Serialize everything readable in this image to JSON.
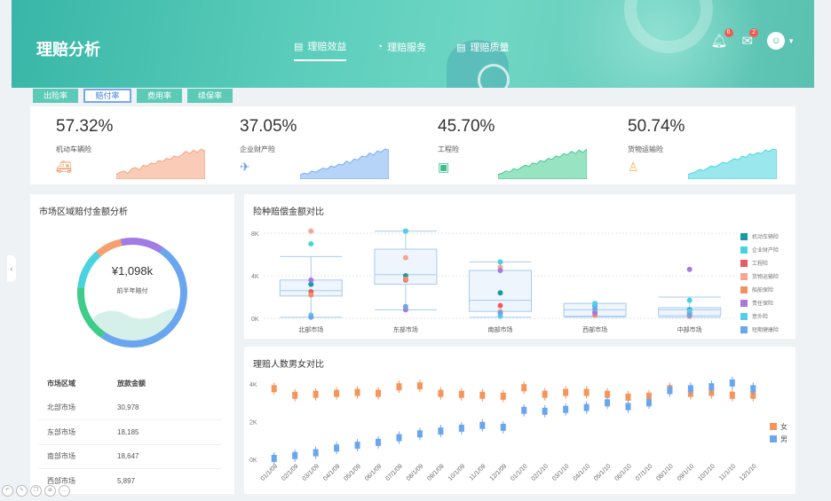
{
  "header": {
    "title": "理赔分析",
    "nav": [
      {
        "label": "理赔效益",
        "icon": "document-icon",
        "active": true
      },
      {
        "label": "理赔服务",
        "icon": "pie-icon",
        "active": false
      },
      {
        "label": "理赔质量",
        "icon": "document-icon",
        "active": false
      }
    ],
    "bell_badge": "6",
    "mail_badge": "2"
  },
  "tabs": [
    {
      "label": "出险率",
      "active": false
    },
    {
      "label": "赔付率",
      "active": true
    },
    {
      "label": "费用率",
      "active": false
    },
    {
      "label": "续保率",
      "active": false
    }
  ],
  "kpis": [
    {
      "value": "57.32%",
      "label": "机动车辆险",
      "color": "#f6a37c",
      "icon": "car-icon"
    },
    {
      "value": "37.05%",
      "label": "企业财产险",
      "color": "#7aaef2",
      "icon": "building-icon"
    },
    {
      "value": "45.70%",
      "label": "工程险",
      "color": "#43cc90",
      "icon": "engineering-icon"
    },
    {
      "value": "50.74%",
      "label": "货物运输险",
      "color": "#47d6df",
      "icon": "cargo-icon"
    }
  ],
  "side": {
    "title": "市场区域赔付金额分析",
    "ring_value": "¥1,098k",
    "ring_label": "前半年赔付",
    "table_headers": [
      "市场区域",
      "放款金额"
    ],
    "rows": [
      [
        "北部市场",
        "30,978"
      ],
      [
        "东部市场",
        "18,185"
      ],
      [
        "南部市场",
        "18,647"
      ],
      [
        "西部市场",
        "5,897"
      ]
    ]
  },
  "chart_data": [
    {
      "type": "box",
      "title": "险种赔偿金额对比",
      "categories": [
        "北部市场",
        "东部市场",
        "南部市场",
        "西部市场",
        "中部市场"
      ],
      "ylim": [
        0,
        8000
      ],
      "yticks": [
        "0K",
        "4K",
        "8K"
      ],
      "boxes": [
        {
          "min": 100,
          "q1": 2100,
          "median": 2600,
          "q3": 3600,
          "max": 5800
        },
        {
          "min": 800,
          "q1": 3200,
          "median": 4100,
          "q3": 6500,
          "max": 8200
        },
        {
          "min": 100,
          "q1": 650,
          "median": 1700,
          "q3": 4500,
          "max": 5300
        },
        {
          "min": 100,
          "q1": 200,
          "median": 800,
          "q3": 1400,
          "max": 1400
        },
        {
          "min": 100,
          "q1": 250,
          "median": 800,
          "q3": 1000,
          "max": 2000
        }
      ],
      "series": [
        {
          "name": "机动车辆险",
          "color": "#179aa6",
          "values": [
            3200,
            4000,
            2400,
            1200,
            800
          ]
        },
        {
          "name": "企业财产险",
          "color": "#45d4df",
          "values": [
            7000,
            8200,
            5300,
            1400,
            1700
          ]
        },
        {
          "name": "工程险",
          "color": "#ec5a66",
          "values": [
            2500,
            3600,
            1200,
            600,
            500
          ]
        },
        {
          "name": "货物运输险",
          "color": "#f3a792",
          "values": [
            8200,
            5700,
            4800,
            700,
            300
          ]
        },
        {
          "name": "船舶保险",
          "color": "#f2905f",
          "values": [
            2200,
            3700,
            600,
            300,
            200
          ]
        },
        {
          "name": "责任保险",
          "color": "#a679e0",
          "values": [
            3600,
            800,
            4500,
            500,
            4600
          ]
        },
        {
          "name": "意外险",
          "color": "#56cde8",
          "values": [
            300,
            8200,
            200,
            1300,
            700
          ]
        },
        {
          "name": "短期健康险",
          "color": "#6aa6f0",
          "values": [
            100,
            1100,
            500,
            900,
            300
          ]
        }
      ]
    },
    {
      "type": "scatter",
      "title": "理赔人数男女对比",
      "x": [
        "01/1/09",
        "02/1/09",
        "03/1/09",
        "04/1/09",
        "05/1/09",
        "06/1/09",
        "07/1/09",
        "08/1/09",
        "09/1/09",
        "10/1/09",
        "11/1/09",
        "12/1/09",
        "01/1/10",
        "02/1/10",
        "03/1/10",
        "04/1/10",
        "05/1/10",
        "06/1/10",
        "07/1/10",
        "08/1/10",
        "09/1/10",
        "10/1/10",
        "11/1/10",
        "12/1/10"
      ],
      "ylim": [
        0,
        4000
      ],
      "yticks": [
        "0K",
        "2K",
        "4K"
      ],
      "series": [
        {
          "name": "女",
          "color": "#f5955a",
          "values": [
            3750,
            3400,
            3450,
            3500,
            3550,
            3500,
            3850,
            3900,
            3500,
            3450,
            3400,
            3350,
            3800,
            3450,
            3550,
            3550,
            3450,
            3300,
            3350,
            3750,
            3500,
            3550,
            3400,
            3400
          ]
        },
        {
          "name": "男",
          "color": "#6aa6f0",
          "values": [
            50,
            200,
            350,
            600,
            750,
            900,
            1150,
            1350,
            1500,
            1650,
            1800,
            1700,
            2600,
            2550,
            2650,
            2750,
            3000,
            2800,
            3000,
            3650,
            3750,
            3850,
            4050,
            3750
          ]
        }
      ]
    }
  ],
  "sparklines": [
    [
      10,
      12,
      13,
      11,
      15,
      16,
      14,
      18,
      17,
      20,
      19,
      22,
      21,
      24,
      23,
      26,
      25,
      27,
      30,
      28,
      31,
      29,
      32,
      30
    ],
    [
      8,
      10,
      9,
      12,
      11,
      13,
      15,
      14,
      17,
      16,
      19,
      18,
      22,
      20,
      24,
      23,
      27,
      26,
      30,
      28,
      32,
      31,
      34,
      33
    ],
    [
      6,
      7,
      9,
      8,
      11,
      10,
      12,
      14,
      13,
      16,
      15,
      18,
      17,
      20,
      19,
      22,
      21,
      24,
      23,
      26,
      24,
      27,
      25,
      28
    ],
    [
      5,
      6,
      7,
      9,
      8,
      10,
      12,
      11,
      13,
      15,
      14,
      16,
      18,
      17,
      20,
      19,
      22,
      21,
      23,
      22,
      25,
      24,
      26,
      25
    ]
  ],
  "ring_segments": [
    {
      "color": "#6aa6f0",
      "fraction": 0.5
    },
    {
      "color": "#3fcc8a",
      "fraction": 0.17
    },
    {
      "color": "#48d3df",
      "fraction": 0.12
    },
    {
      "color": "#f5a06e",
      "fraction": 0.08
    },
    {
      "color": "#a07ce4",
      "fraction": 0.13
    }
  ]
}
